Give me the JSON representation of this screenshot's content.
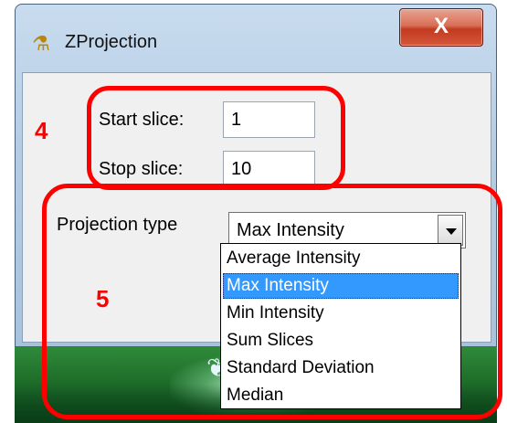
{
  "window": {
    "title": "ZProjection",
    "close_glyph": "X",
    "icon": "microscope-icon"
  },
  "form": {
    "start_slice_label": "Start slice:",
    "start_slice_value": "1",
    "stop_slice_label": "Stop slice:",
    "stop_slice_value": "10",
    "projection_type_label": "Projection type",
    "projection_type_value": "Max Intensity"
  },
  "dropdown": {
    "options": [
      "Average Intensity",
      "Max Intensity",
      "Min Intensity",
      "Sum Slices",
      "Standard Deviation",
      "Median"
    ],
    "selected": "Max Intensity"
  },
  "annotations": {
    "box_4_number": "4",
    "box_5_number": "5",
    "color": "#ff0000"
  },
  "desktop": {
    "wallpaper_icon": "butterfly-icon"
  }
}
